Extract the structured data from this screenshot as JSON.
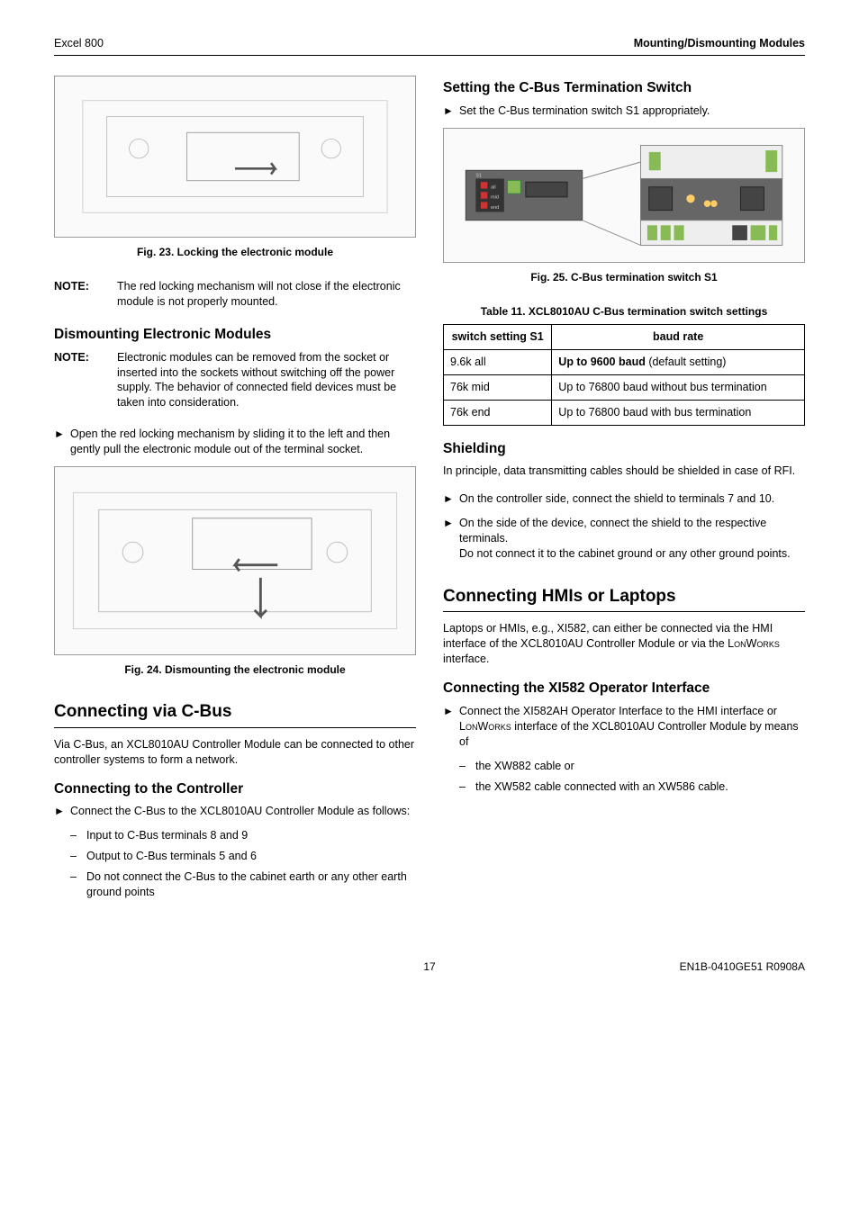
{
  "header": {
    "left": "Excel 800",
    "right": "Mounting/Dismounting Modules"
  },
  "left_col": {
    "fig23_caption": "Fig. 23. Locking the electronic module",
    "note1_label": "NOTE:",
    "note1_body": "The red locking mechanism will not close if the electronic module is not properly mounted.",
    "dismount_heading": "Dismounting Electronic Modules",
    "note2_label": "NOTE:",
    "note2_body": "Electronic modules can be removed from the socket or inserted into the sockets without switching off the power supply. The behavior of connected field devices must be taken into consideration.",
    "dismount_step": "Open the red locking mechanism by sliding it to the left and then gently pull the electronic module out of the terminal socket.",
    "fig24_caption": "Fig. 24. Dismounting the electronic module",
    "cbus_heading": "Connecting via C-Bus",
    "cbus_intro": "Via C-Bus, an XCL8010AU Controller Module can be connected to other controller systems to form a network.",
    "conn_ctrl_heading": "Connecting to the Controller",
    "conn_ctrl_step": "Connect the C-Bus to the XCL8010AU Controller Module as follows:",
    "conn_ctrl_sub1": "Input to C-Bus terminals 8 and 9",
    "conn_ctrl_sub2": "Output to C-Bus terminals 5 and 6",
    "conn_ctrl_sub3": "Do not connect the C-Bus to the cabinet earth or any other earth ground points"
  },
  "right_col": {
    "set_term_heading": "Setting the C-Bus Termination Switch",
    "set_term_step": "Set the C-Bus termination switch S1 appropriately.",
    "fig25_caption": "Fig. 25. C-Bus termination switch S1",
    "table_caption": "Table 11. XCL8010AU C-Bus termination switch settings",
    "table": {
      "h1": "switch setting S1",
      "h2": "baud rate",
      "rows": [
        {
          "c1": "9.6k all",
          "c2_prefix": "Up to 9600 baud",
          "c2_suffix": " (default setting)"
        },
        {
          "c1": "76k mid",
          "c2_prefix": "",
          "c2_suffix": "Up to 76800 baud without bus termination"
        },
        {
          "c1": "76k end",
          "c2_prefix": "",
          "c2_suffix": "Up to 76800 baud with bus termination"
        }
      ]
    },
    "shield_heading": "Shielding",
    "shield_intro": "In principle, data transmitting cables should be shielded in case of RFI.",
    "shield_b1": "On the controller side, connect the shield to terminals 7 and 10.",
    "shield_b2a": "On the side of the device, connect the shield to the respective terminals.",
    "shield_b2b": "Do not connect it to the cabinet ground or any other ground points.",
    "hmi_heading": "Connecting HMIs or Laptops",
    "hmi_intro_a": "Laptops or HMIs, e.g., XI582, can either be connected via the HMI interface of the XCL8010AU Controller Module or via the ",
    "hmi_intro_b": "LonWorks",
    "hmi_intro_c": " interface.",
    "xi582_heading": "Connecting the XI582 Operator Interface",
    "xi582_step_a": "Connect the XI582AH Operator Interface to the HMI interface or ",
    "xi582_step_b": "LonWorks",
    "xi582_step_c": " interface of the XCL8010AU Controller Module by means of",
    "xi582_sub1": "the XW882 cable or",
    "xi582_sub2": "the XW582 cable connected with an XW586 cable."
  },
  "footer": {
    "page": "17",
    "doc": "EN1B-0410GE51 R0908A"
  }
}
